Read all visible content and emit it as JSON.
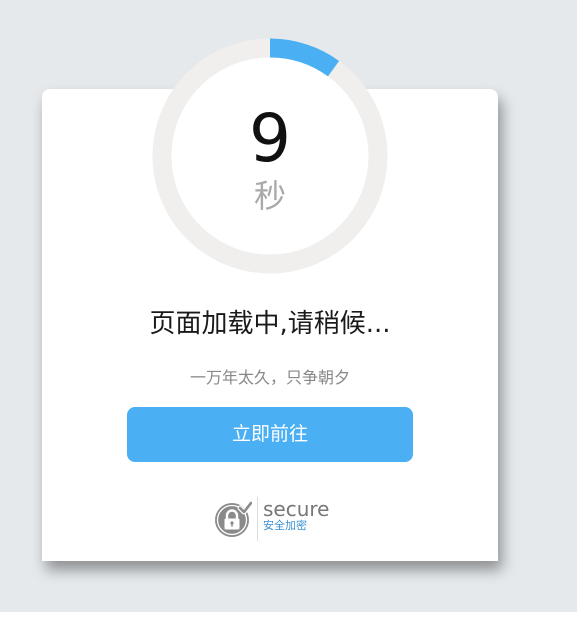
{
  "countdown": {
    "value": "9",
    "unit": "秒",
    "progress_fraction": 0.1,
    "track_color": "#f0efee",
    "progress_color": "#4aaff3"
  },
  "loading": {
    "title": "页面加载中,请稍候...",
    "subtitle": "一万年太久，只争朝夕"
  },
  "action": {
    "go_label": "立即前往",
    "button_color": "#4aaff3"
  },
  "secure_badge": {
    "label": "secure",
    "sublabel": "安全加密",
    "icon": "lock-check-icon"
  }
}
